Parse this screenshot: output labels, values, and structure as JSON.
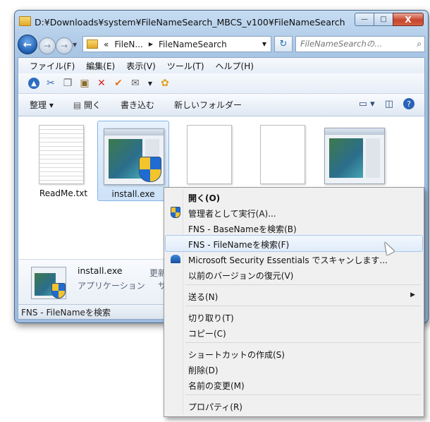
{
  "window": {
    "title": "D:¥Downloads¥system¥FileNameSearch_MBCS_v100¥FileNameSearch",
    "controls": {
      "minimize": "—",
      "maximize": "□",
      "close": "X"
    }
  },
  "nav": {
    "back": "←",
    "forward": "→",
    "address": {
      "prefix": "«",
      "seg1": "FileN...",
      "seg2": "FileNameSearch"
    },
    "search_placeholder": "FileNameSearchの...",
    "refresh": "↻"
  },
  "menubar": [
    "ファイル(F)",
    "編集(E)",
    "表示(V)",
    "ツール(T)",
    "ヘルプ(H)"
  ],
  "iconbar": [
    "up-icon",
    "cut-icon",
    "copy-icon",
    "paste-icon",
    "delete-icon",
    "check-icon",
    "email-icon",
    "dropdown-icon",
    "color-icon"
  ],
  "commandbar": {
    "organize": "整理 ▾",
    "open": "開く",
    "burn": "書き込む",
    "new_folder": "新しいフォルダー"
  },
  "files": [
    {
      "name": "ReadMe.txt",
      "kind": "text"
    },
    {
      "name": "install.exe",
      "kind": "app-shield",
      "selected": true
    },
    {
      "name": "",
      "kind": "blank"
    },
    {
      "name": "",
      "kind": "blank"
    },
    {
      "name": "",
      "kind": "app"
    }
  ],
  "details": {
    "name": "install.exe",
    "type": "アプリケーション",
    "meta_label": "更新",
    "meta2": "サ"
  },
  "status": "FNS - FileNameを検索",
  "context_menu": {
    "groups": [
      [
        {
          "label": "開く(O)",
          "bold": true
        },
        {
          "label": "管理者として実行(A)...",
          "icon": "shield-icon"
        },
        {
          "label": "FNS - BaseNameを検索(B)"
        },
        {
          "label": "FNS - FileNameを検索(F)",
          "hover": true
        },
        {
          "label": "Microsoft Security Essentials でスキャンします...",
          "icon": "mse-icon"
        },
        {
          "label": "以前のバージョンの復元(V)"
        }
      ],
      [
        {
          "label": "送る(N)",
          "submenu": true
        }
      ],
      [
        {
          "label": "切り取り(T)"
        },
        {
          "label": "コピー(C)"
        }
      ],
      [
        {
          "label": "ショートカットの作成(S)"
        },
        {
          "label": "削除(D)"
        },
        {
          "label": "名前の変更(M)"
        }
      ],
      [
        {
          "label": "プロパティ(R)"
        }
      ]
    ]
  }
}
